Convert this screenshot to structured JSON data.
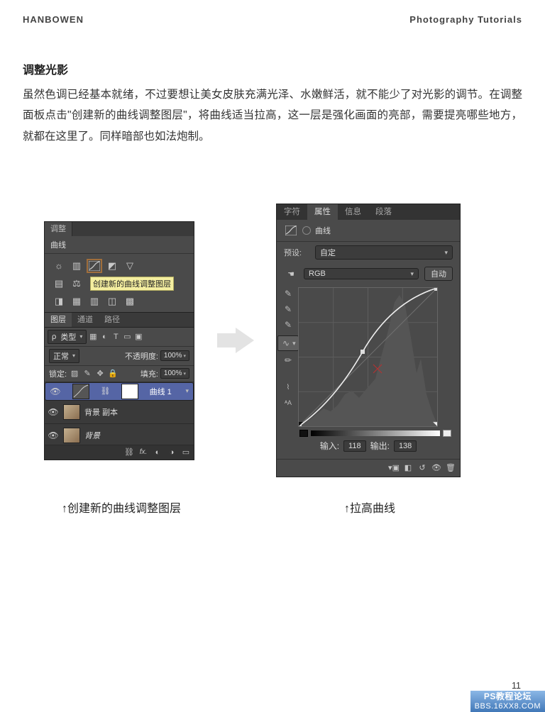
{
  "header": {
    "left": "HANBOWEN",
    "right": "Photography Tutorials"
  },
  "section_title": "调整光影",
  "body_text": "虽然色调已经基本就绪，不过要想让美女皮肤充满光泽、水嫩鲜活，就不能少了对光影的调节。在调整面板点击\"创建新的曲线调整图层\"，将曲线适当拉高，这一层是强化画面的亮部，需要提亮哪些地方，就都在这里了。同样暗部也如法炮制。",
  "left_panel": {
    "adjust_tab": "调整",
    "curves_label": "曲线",
    "tooltip": "创建新的曲线调整图层",
    "tabs": {
      "layer": "图层",
      "channel": "通道",
      "path": "路径"
    },
    "type_dd": "类型",
    "blend_mode": "正常",
    "opacity_label": "不透明度:",
    "opacity_value": "100%",
    "lock_label": "锁定:",
    "fill_label": "填充:",
    "fill_value": "100%",
    "layers": [
      {
        "name": "曲线 1"
      },
      {
        "name": "背景 副本"
      },
      {
        "name": "背景"
      }
    ]
  },
  "right_panel": {
    "tabs": [
      "字符",
      "属性",
      "信息",
      "段落"
    ],
    "active_tab": 1,
    "icon_label": "曲线",
    "preset_label": "预设:",
    "preset_value": "自定",
    "channel_value": "RGB",
    "auto_btn": "自动",
    "input_label": "输入:",
    "input_value": "118",
    "output_label": "输出:",
    "output_value": "138"
  },
  "captions": {
    "left": "↑创建新的曲线调整图层",
    "right": "↑拉高曲线"
  },
  "page_number": "11",
  "watermark": {
    "line1": "PS教程论坛",
    "line2": "BBS.16XX8.COM"
  }
}
